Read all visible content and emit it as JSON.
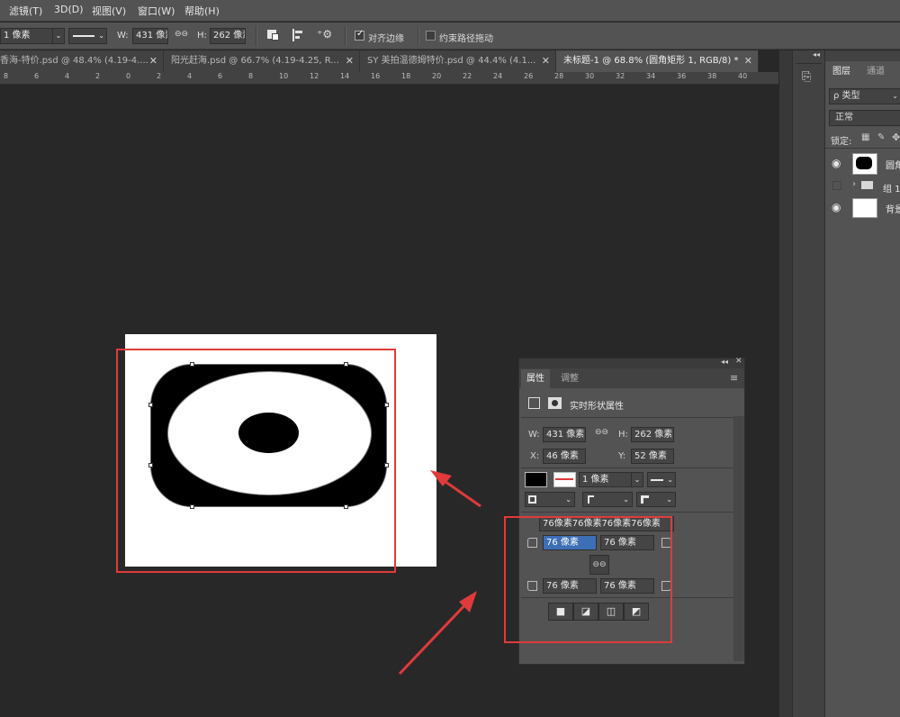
{
  "menubar": {
    "items": [
      "滤镜(T)",
      "3D(D)",
      "视图(V)",
      "窗口(W)",
      "帮助(H)"
    ]
  },
  "options": {
    "stroke_width": "1 像素",
    "w_label": "W:",
    "w_value": "431 像素",
    "h_label": "H:",
    "h_value": "262 像素",
    "align_edges_label": "对齐边缘",
    "constrain_path_label": "约束路径拖动"
  },
  "tabs": [
    {
      "label": "香海-特价.psd @ 48.4% (4.19-4...."
    },
    {
      "label": "阳光赶海.psd @ 66.7% (4.19-4.25, R..."
    },
    {
      "label": "SY 美拍温德姆特价.psd @ 44.4% (4.1..."
    },
    {
      "label": "未标题-1 @ 68.8% (圆角矩形 1, RGB/8) *"
    }
  ],
  "ruler": {
    "ticks": [
      "8",
      "6",
      "4",
      "2",
      "0",
      "2",
      "4",
      "6",
      "8",
      "10",
      "12",
      "14",
      "16",
      "18",
      "20",
      "22",
      "24",
      "26",
      "28",
      "30",
      "32",
      "34",
      "36",
      "38",
      "40"
    ]
  },
  "layers_panel": {
    "tabs": [
      "图层",
      "通道"
    ],
    "filter_label": "ρ 类型",
    "blend_mode": "正常",
    "lock_label": "锁定:",
    "layers": [
      {
        "name": "圆角"
      },
      {
        "name": "组 1"
      },
      {
        "name": "背景"
      }
    ]
  },
  "properties": {
    "tabs": [
      "属性",
      "调整"
    ],
    "title": "实时形状属性",
    "w_label": "W:",
    "w_value": "431 像素",
    "h_label": "H:",
    "h_value": "262 像素",
    "x_label": "X:",
    "x_value": "46 像素",
    "y_label": "Y:",
    "y_value": "52 像素",
    "stroke_size": "1 像素",
    "corner_summary": "76像素76像素76像素76像素",
    "corner_tl": "76 像素",
    "corner_tr": "76 像素",
    "corner_bl": "76 像素",
    "corner_br": "76 像素"
  },
  "colors": {
    "accent_red": "#e03a3a",
    "selection_blue": "#3d6fb6"
  }
}
